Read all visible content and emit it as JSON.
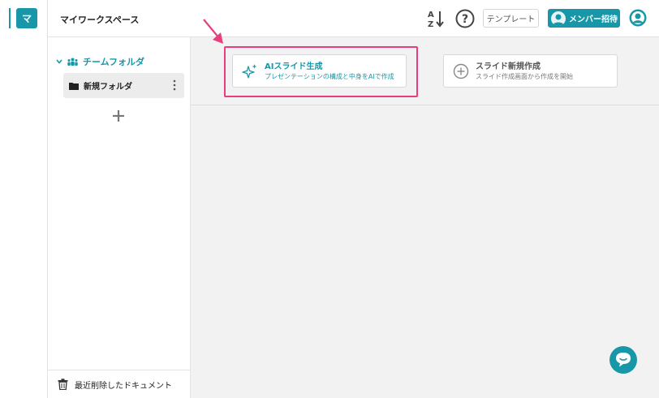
{
  "rail": {
    "workspace_initial": "マ"
  },
  "header": {
    "workspace_title": "マイワークスペース",
    "template_label": "テンプレート",
    "invite_label": "メンバー招待"
  },
  "sidebar": {
    "team_label": "チームフォルダ",
    "folders": [
      {
        "label": "新規フォルダ"
      }
    ],
    "footer_label": "最近削除したドキュメント"
  },
  "main": {
    "ai_card": {
      "title": "AIスライド生成",
      "subtitle": "プレゼンテーションの構成と中身をAIで作成"
    },
    "new_card": {
      "title": "スライド新規作成",
      "subtitle": "スライド作成画面から作成を開始"
    }
  },
  "colors": {
    "accent": "#1797a8",
    "highlight": "#e83d7f"
  },
  "icons": [
    "sort-az-icon",
    "help-icon",
    "invite-user-icon",
    "user-avatar-icon",
    "chevron-down-icon",
    "team-icon",
    "folder-icon",
    "kebab-icon",
    "plus-icon",
    "trash-icon",
    "sparkle-icon",
    "add-circle-icon",
    "chat-icon"
  ]
}
